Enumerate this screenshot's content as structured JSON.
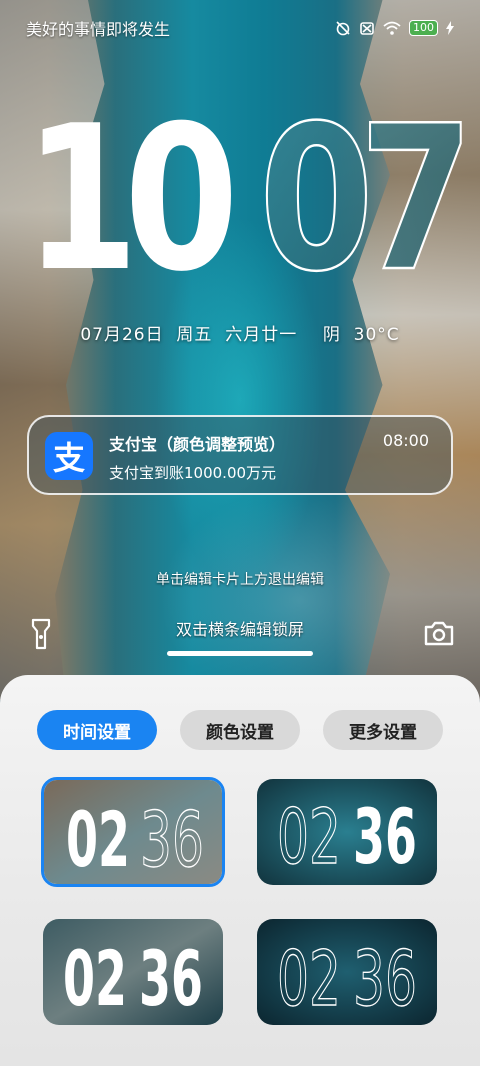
{
  "status_bar": {
    "title": "美好的事情即将发生",
    "icons": [
      "alarm-off-icon",
      "sim-off-icon",
      "wifi-icon",
      "battery-icon",
      "charging-icon"
    ],
    "battery": "100"
  },
  "lockscreen": {
    "hour": "10",
    "minute": "07",
    "date": "07月26日",
    "weekday": "周五",
    "lunar": "六月廿一",
    "weather": "阴",
    "temperature": "30°C"
  },
  "notification": {
    "app_icon_glyph": "支",
    "title": "支付宝（颜色调整预览）",
    "time": "08:00",
    "body": "支付宝到账1000.00万元"
  },
  "hints": {
    "edit_exit": "单击编辑卡片上方退出编辑",
    "edit_lockscreen": "双击横条编辑锁屏"
  },
  "panel": {
    "tabs": [
      {
        "label": "时间设置",
        "active": true
      },
      {
        "label": "颜色设置",
        "active": false
      },
      {
        "label": "更多设置",
        "active": false
      }
    ],
    "styles": [
      {
        "hour": "02",
        "minute": "36",
        "selected": true
      },
      {
        "hour": "02",
        "minute": "36",
        "selected": false
      },
      {
        "hour": "02",
        "minute": "36",
        "selected": false
      },
      {
        "hour": "02",
        "minute": "36",
        "selected": false
      }
    ]
  },
  "colors": {
    "accent": "#1a84f2",
    "alipay": "#1677ff"
  }
}
